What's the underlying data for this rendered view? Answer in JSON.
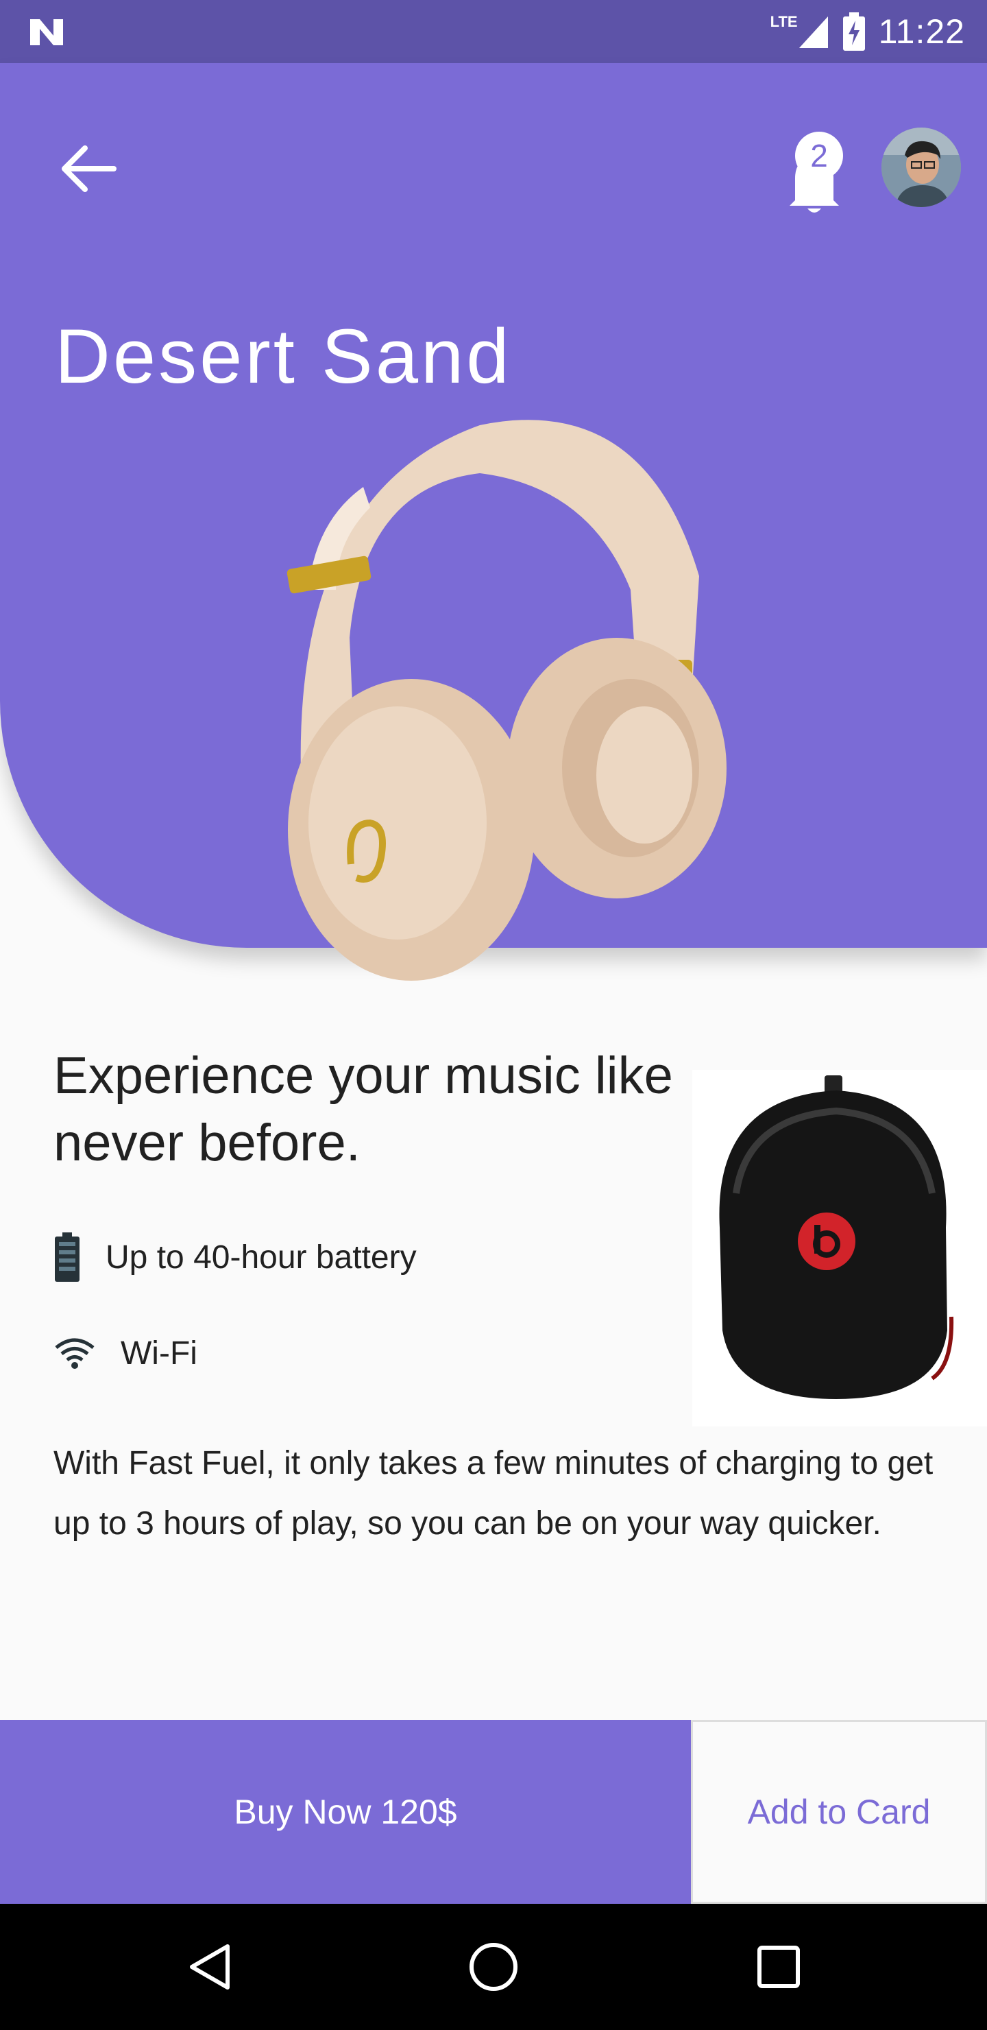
{
  "status_bar": {
    "network": "LTE",
    "time": "11:22",
    "icons": [
      "notification-n-icon",
      "signal-icon",
      "battery-charging-icon"
    ]
  },
  "header": {
    "back_icon": "arrow-back-icon",
    "notification_icon": "bell-icon",
    "notification_count": "2",
    "avatar": "user-avatar"
  },
  "product": {
    "title": "Desert Sand",
    "headline": "Experience your music like never before.",
    "features": [
      {
        "icon": "battery-icon",
        "label": "Up to 40-hour battery"
      },
      {
        "icon": "wifi-icon",
        "label": "Wi-Fi"
      }
    ],
    "description": "With Fast Fuel, it only takes a few minutes of charging to get up to 3 hours of play, so you can be on your way quicker."
  },
  "actions": {
    "buy_label": "Buy Now 120$",
    "cart_label": "Add to Card"
  },
  "colors": {
    "primary": "#7b6bd6",
    "status_bar": "#5d53a8",
    "background": "#fafafa"
  }
}
